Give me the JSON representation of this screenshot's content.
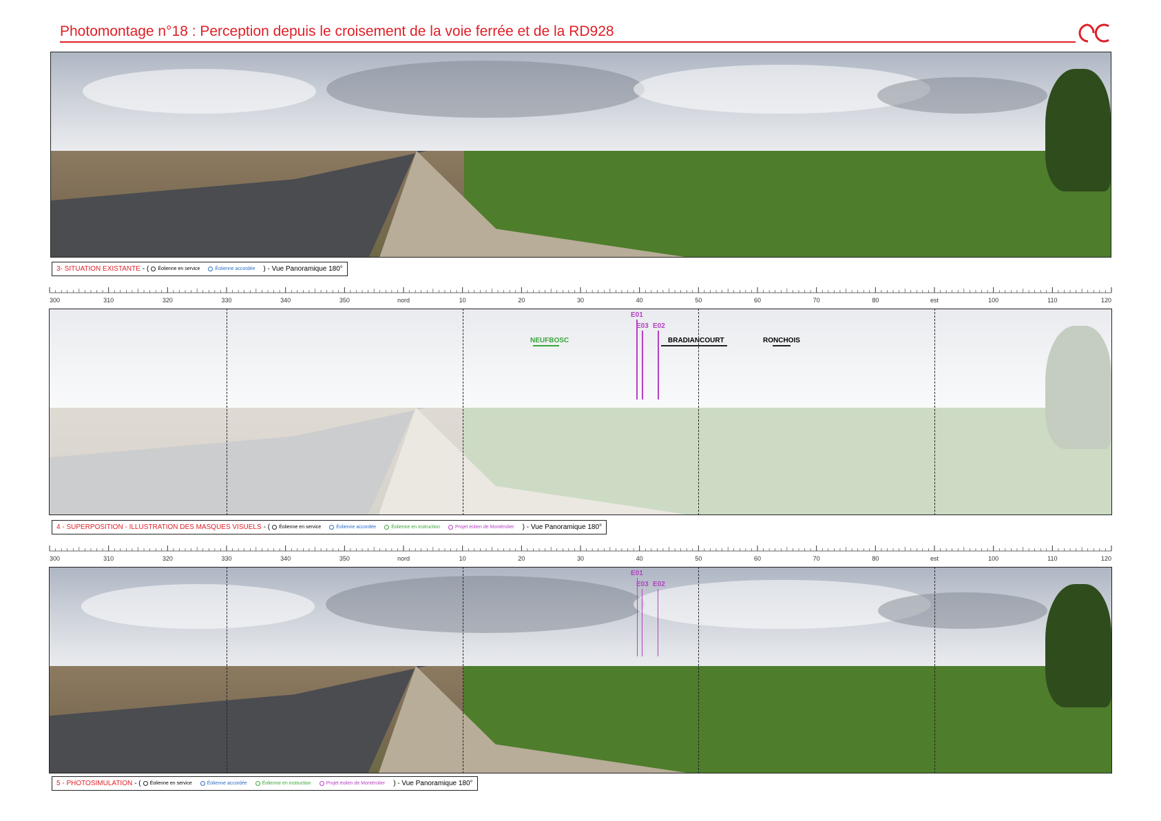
{
  "header": {
    "title": "Photomontage n°18 : Perception depuis le croisement de la voie ferrée et de la RD928",
    "logo_text": "AC",
    "accent_color": "#e01e26"
  },
  "legend_colors": {
    "service": "#222222",
    "accordee": "#2b6cc4",
    "instruction": "#3aa53a",
    "projet": "#b43fc2"
  },
  "panel3": {
    "caption_lead": "3- SITUATION EXISTANTE",
    "sep": "- (",
    "legend": [
      {
        "label": "Éolienne en service",
        "color": "#222222"
      },
      {
        "label": "Éolienne accordée",
        "color": "#2b6cc4"
      }
    ],
    "tail": ") - Vue Panoramique 180°"
  },
  "panel4": {
    "caption_lead": "4 - SUPERPOSITION - ILLUSTRATION DES MASQUES VISUELS",
    "sep": "- (",
    "legend": [
      {
        "label": "Éolienne en service",
        "color": "#222222"
      },
      {
        "label": "Éolienne accordée",
        "color": "#2b6cc4"
      },
      {
        "label": "Éolienne en instruction",
        "color": "#3aa53a"
      },
      {
        "label": "Projet éolien de Montérolier",
        "color": "#b43fc2"
      }
    ],
    "tail": ") - Vue Panoramique 180°",
    "towns": [
      {
        "name": "NEUFBOSC",
        "color": "#3aa53a"
      },
      {
        "name": "BRADIANCOURT",
        "color": "#222222"
      },
      {
        "name": "RONCHOIS",
        "color": "#222222"
      }
    ],
    "turbines": [
      "E01",
      "E03",
      "E02"
    ]
  },
  "panel5": {
    "caption_lead": "5 - PHOTOSIMULATION",
    "sep": "- (",
    "legend": [
      {
        "label": "Éolienne en service",
        "color": "#222222"
      },
      {
        "label": "Éolienne accordée",
        "color": "#2b6cc4"
      },
      {
        "label": "Éolienne en instruction",
        "color": "#3aa53a"
      },
      {
        "label": "Projet éolien de Montérolier",
        "color": "#b43fc2"
      }
    ],
    "tail": ") - Vue Panoramique 180°",
    "turbines": [
      "E01",
      "E03",
      "E02"
    ]
  },
  "ruler": {
    "labels": [
      "300",
      "310",
      "320",
      "330",
      "340",
      "350",
      "nord",
      "10",
      "20",
      "30",
      "40",
      "50",
      "60",
      "70",
      "80",
      "est",
      "100",
      "110",
      "120"
    ]
  },
  "guide_labels": [
    "330",
    "10",
    "50",
    "90"
  ]
}
